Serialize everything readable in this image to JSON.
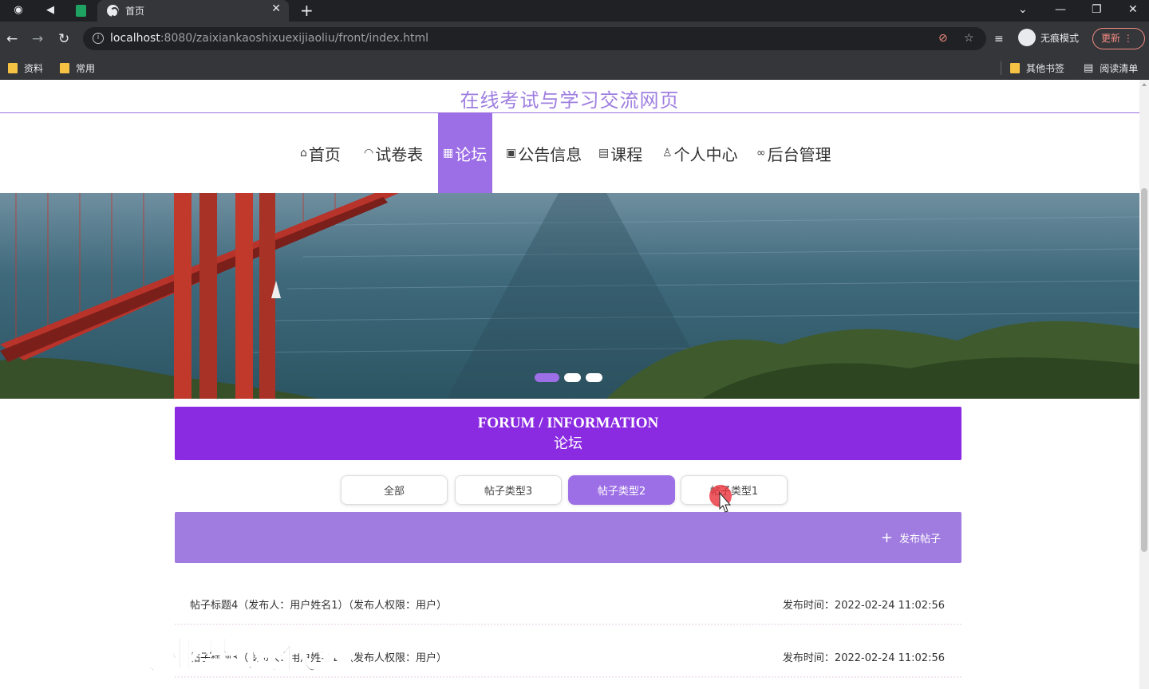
{
  "browser": {
    "tab_title": "首页",
    "url_host": "localhost",
    "url_rest": ":8080/zaixiankaoshixuexijiaoliu/front/index.html",
    "incognito_label": "无痕模式",
    "update_label": "更新",
    "bookmarks": [
      "资料",
      "常用"
    ],
    "bookmarks_right": [
      "其他书签",
      "阅读清单"
    ]
  },
  "site": {
    "title": "在线考试与学习交流网页",
    "nav": [
      {
        "icon": "home-icon",
        "label": "首页"
      },
      {
        "icon": "dashboard-icon",
        "label": "试卷表"
      },
      {
        "icon": "forum-icon",
        "label": "论坛",
        "active": true
      },
      {
        "icon": "gift-icon",
        "label": "公告信息"
      },
      {
        "icon": "document-icon",
        "label": "课程"
      },
      {
        "icon": "user-icon",
        "label": "个人中心"
      },
      {
        "icon": "link-icon",
        "label": "后台管理"
      }
    ]
  },
  "carousel": {
    "slides": 3,
    "active_index": 0
  },
  "forum": {
    "heading_en": "FORUM / INFORMATION",
    "heading_cn": "论坛",
    "filters": [
      {
        "label": "全部"
      },
      {
        "label": "帖子类型3"
      },
      {
        "label": "帖子类型2",
        "active": true
      },
      {
        "label": "帖子类型1"
      }
    ],
    "publish_label": "发布帖子",
    "posts": [
      {
        "title": "帖子标题4（发布人：用户姓名1）（发布人权限：用户）",
        "time": "发布时间：2022-02-24 11:02:56"
      },
      {
        "title": "帖子标题3（发布人：用户姓名1）（发布人权限：用户）",
        "time": "发布时间：2022-02-24 11:02:56"
      }
    ]
  },
  "watermark": "专业毕设代做",
  "colors": {
    "accent": "#9d6fe6",
    "header_purple": "#8a2be2",
    "publish_bar": "#a07ce0",
    "title": "#9f7fe0"
  }
}
